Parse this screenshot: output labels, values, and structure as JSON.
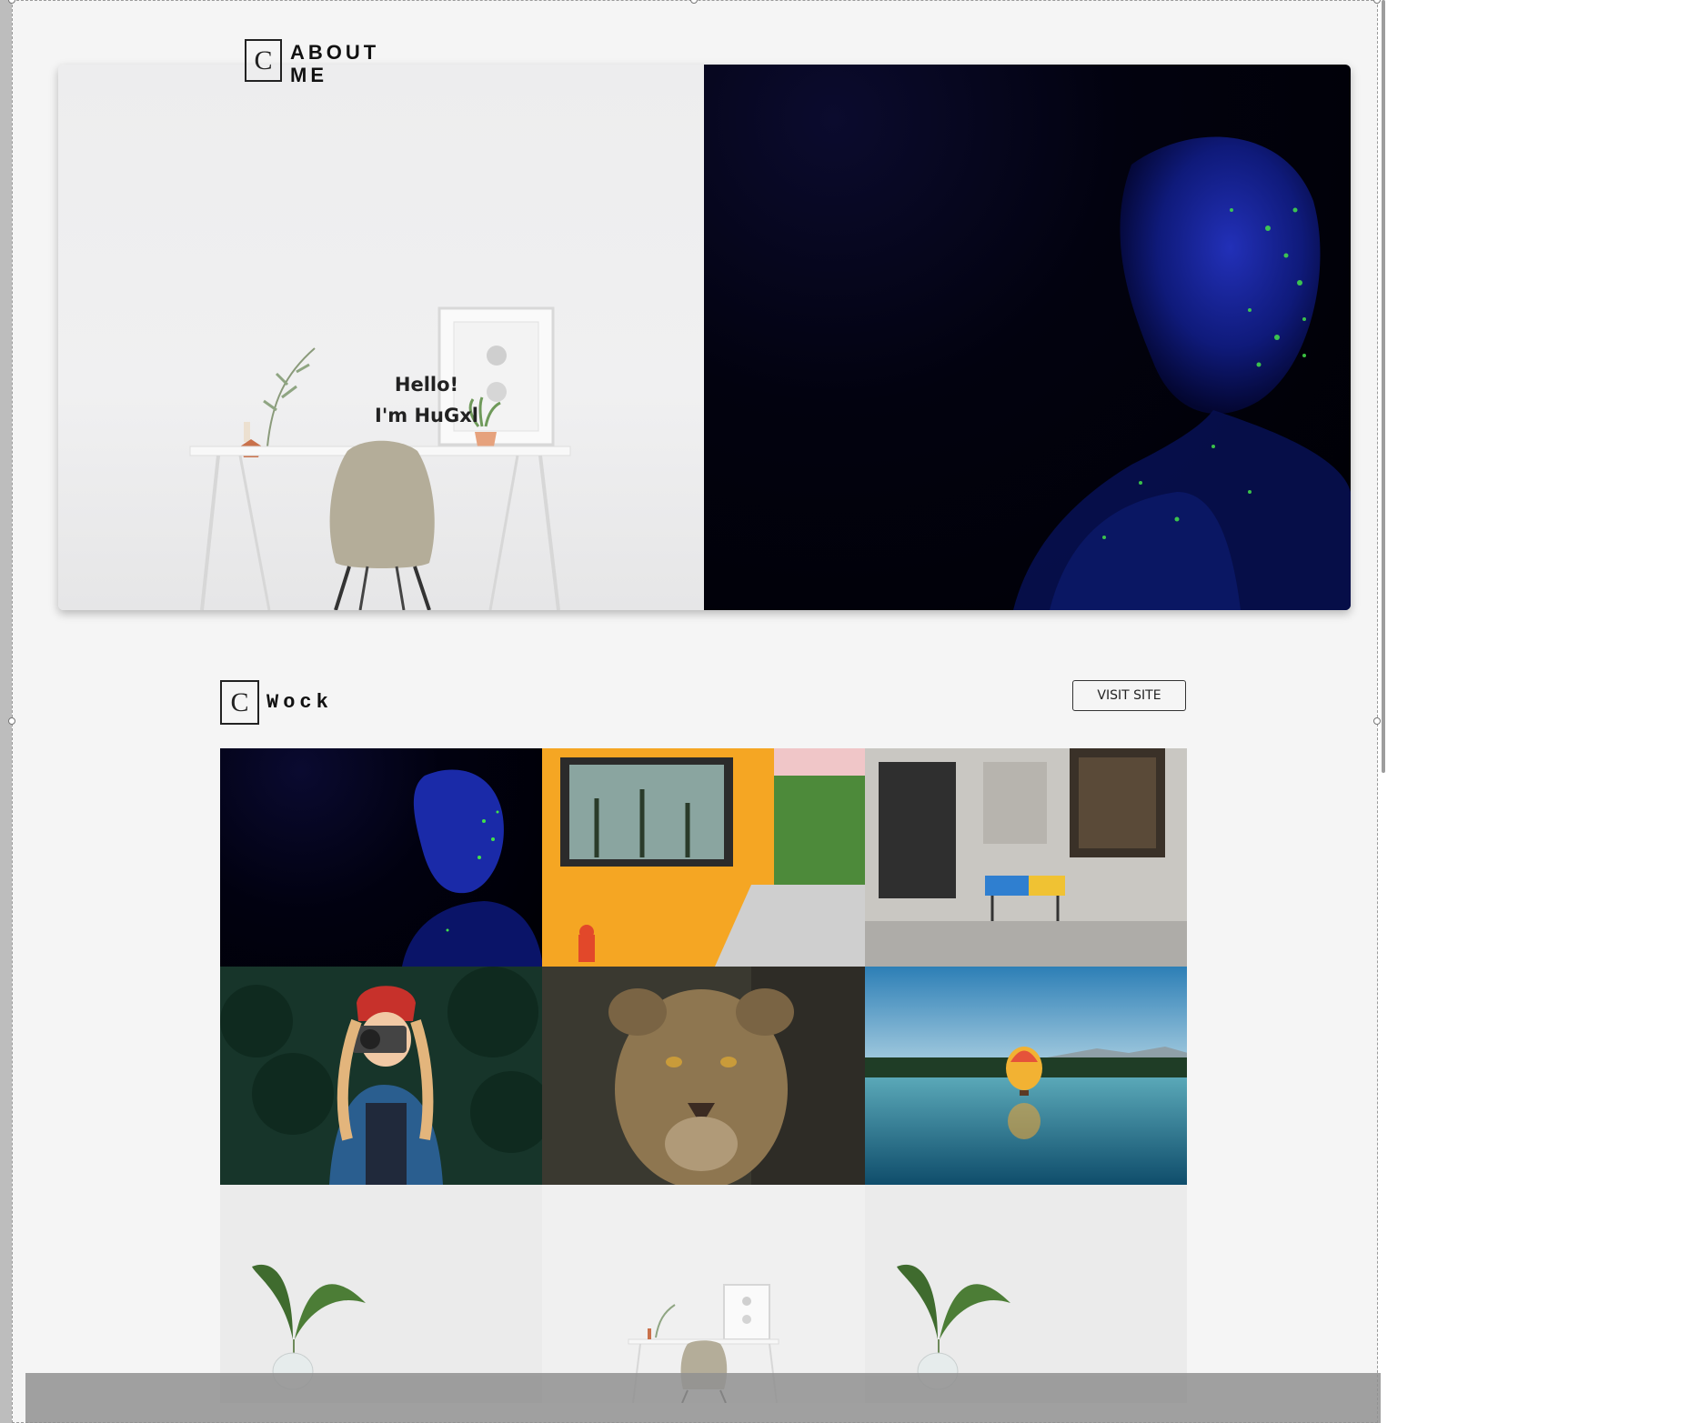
{
  "about": {
    "logo_letter": "C",
    "title_line1": "ABOUT",
    "title_line2": "ME",
    "greeting_line1": "Hello!",
    "greeting_line2": "I'm HuGxl"
  },
  "work": {
    "logo_letter": "C",
    "title": "Wock",
    "visit_label": "VISIT SITE",
    "tiles": [
      "glitter-face-photo",
      "cactus-mural-wall-photo",
      "bench-stone-building-photo",
      "woman-camera-red-hat-photo",
      "lioness-portrait-photo",
      "hot-air-balloon-lake-photo",
      "plant-vase-photo",
      "desk-chair-photo",
      "plant-vase-photo"
    ]
  },
  "colors": {
    "canvas": "#f5f5f5",
    "text": "#111111",
    "overlay_bar": "#919191"
  }
}
